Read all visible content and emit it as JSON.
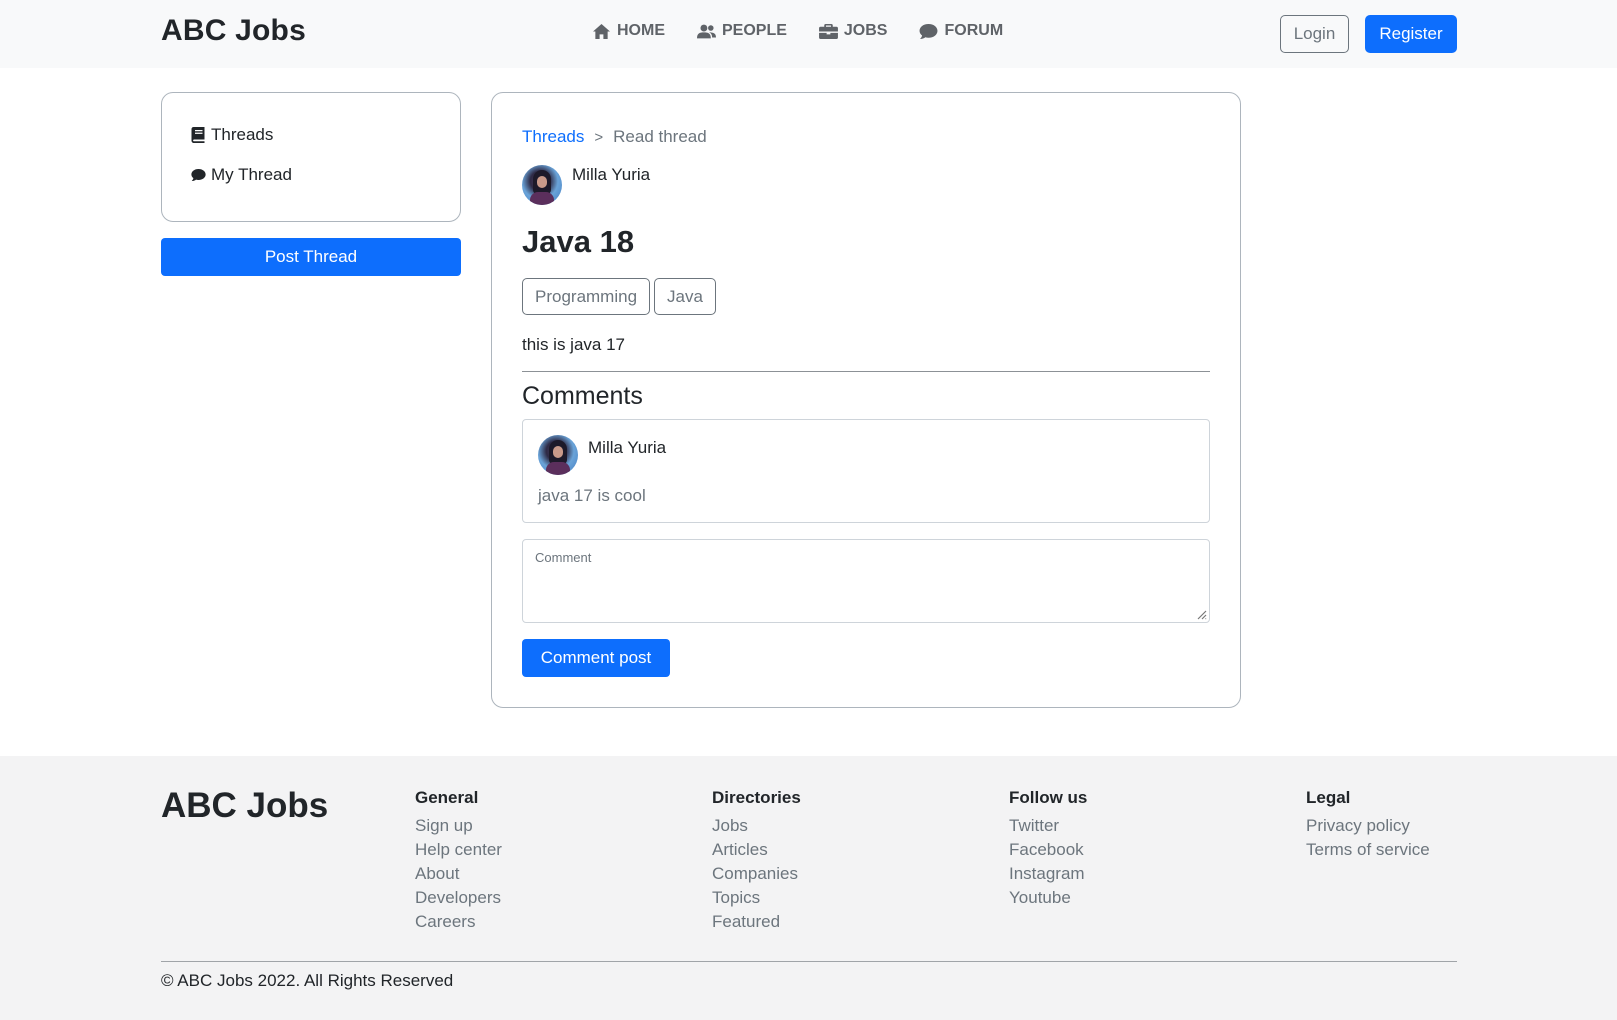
{
  "navbar": {
    "brand": "ABC Jobs",
    "links": [
      {
        "label": "HOME",
        "icon": "home-icon"
      },
      {
        "label": "PEOPLE",
        "icon": "users-icon"
      },
      {
        "label": "JOBS",
        "icon": "briefcase-icon"
      },
      {
        "label": "FORUM",
        "icon": "chat-icon"
      }
    ],
    "login_label": "Login",
    "register_label": "Register"
  },
  "sidebar": {
    "items": [
      {
        "label": "Threads",
        "icon": "book-icon"
      },
      {
        "label": "My Thread",
        "icon": "chat-icon"
      }
    ],
    "post_thread_label": "Post Thread"
  },
  "thread": {
    "breadcrumb": {
      "parent": "Threads",
      "separator": ">",
      "current": "Read thread"
    },
    "author": "Milla Yuria",
    "title": "Java 18",
    "tags": [
      "Programming",
      "Java"
    ],
    "body": "this is java 17"
  },
  "comments": {
    "heading": "Comments",
    "items": [
      {
        "author": "Milla Yuria",
        "text": "java 17 is cool"
      }
    ],
    "input_label": "Comment",
    "post_label": "Comment post"
  },
  "footer": {
    "brand": "ABC Jobs",
    "columns": [
      {
        "heading": "General",
        "links": [
          "Sign up",
          "Help center",
          "About",
          "Developers",
          "Careers"
        ]
      },
      {
        "heading": "Directories",
        "links": [
          "Jobs",
          "Articles",
          "Companies",
          "Topics",
          "Featured"
        ]
      },
      {
        "heading": "Follow us",
        "links": [
          "Twitter",
          "Facebook",
          "Instagram",
          "Youtube"
        ]
      },
      {
        "heading": "Legal",
        "links": [
          "Privacy policy",
          "Terms of service"
        ]
      }
    ],
    "copyright": "© ABC Jobs 2022. All Rights Reserved"
  },
  "colors": {
    "primary": "#0d6efd",
    "nav_bg": "#f8f9fa",
    "footer_bg": "#f3f3f4",
    "muted": "#6c757d"
  }
}
